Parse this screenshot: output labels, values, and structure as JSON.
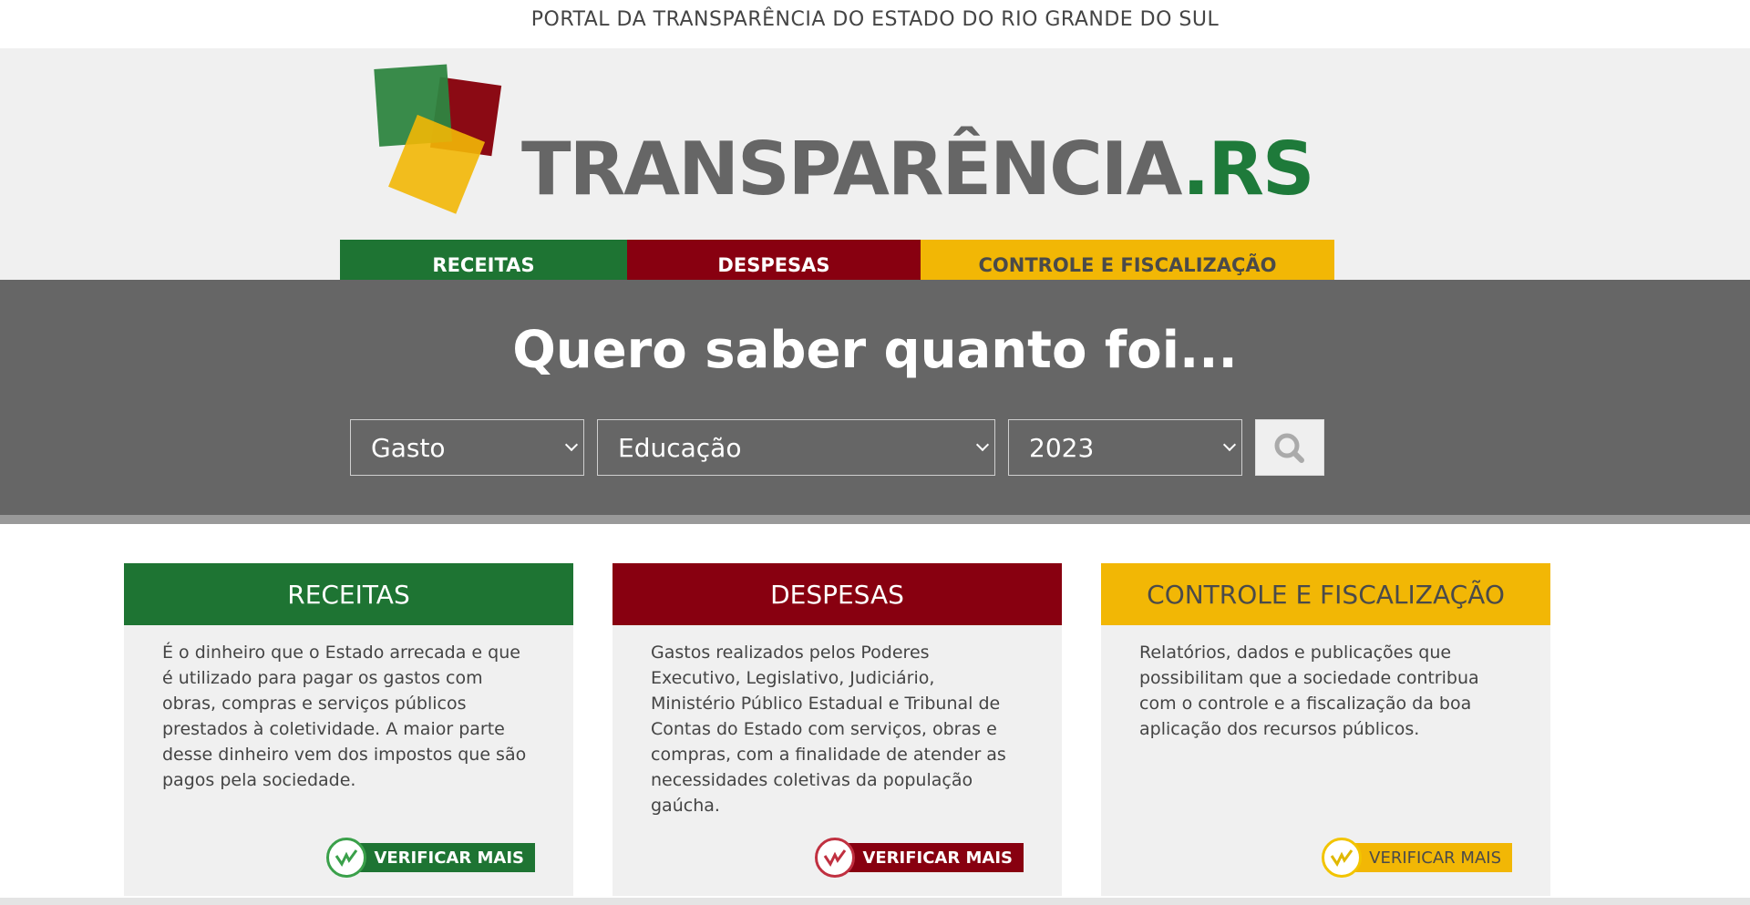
{
  "topbar": {
    "portal_title": "PORTAL DA TRANSPARÊNCIA DO ESTADO DO RIO GRANDE DO SUL"
  },
  "logo": {
    "word_main": "TRANSPARÊNCIA",
    "word_suffix": ".RS",
    "colors": {
      "green": "#2e8540",
      "red": "#8b0a14",
      "yellow": "#f2b705"
    }
  },
  "nav": {
    "items": [
      {
        "label": "RECEITAS",
        "color": "#1e7433"
      },
      {
        "label": "DESPESAS",
        "color": "#880010"
      },
      {
        "label": "CONTROLE E FISCALIZAÇÃO",
        "color": "#f2b705"
      }
    ]
  },
  "search": {
    "title": "Quero saber quanto foi...",
    "selects": [
      {
        "value": "Gasto"
      },
      {
        "value": "Educação"
      },
      {
        "value": "2023"
      }
    ],
    "button_icon": "search-icon"
  },
  "cards": [
    {
      "title": "RECEITAS",
      "text": "É o dinheiro que o Estado arrecada e que é utilizado para pagar os gastos com obras, compras e serviços públicos prestados à coletividade. A maior parte desse dinheiro vem dos impostos que são pagos pela sociedade.",
      "cta": "VERIFICAR MAIS"
    },
    {
      "title": "DESPESAS",
      "text": "Gastos realizados pelos Poderes Executivo, Legislativo, Judiciário, Ministério Público Estadual e Tribunal de Contas do Estado com serviços, obras e compras, com a finalidade de atender as necessidades coletivas da população gaúcha.",
      "cta": "VERIFICAR MAIS"
    },
    {
      "title": "CONTROLE E FISCALIZAÇÃO",
      "text": "Relatórios, dados e publicações que possibilitam que a sociedade contribua com o controle e a fiscalização da boa aplicação dos recursos públicos.",
      "cta": "VERIFICAR MAIS"
    }
  ]
}
